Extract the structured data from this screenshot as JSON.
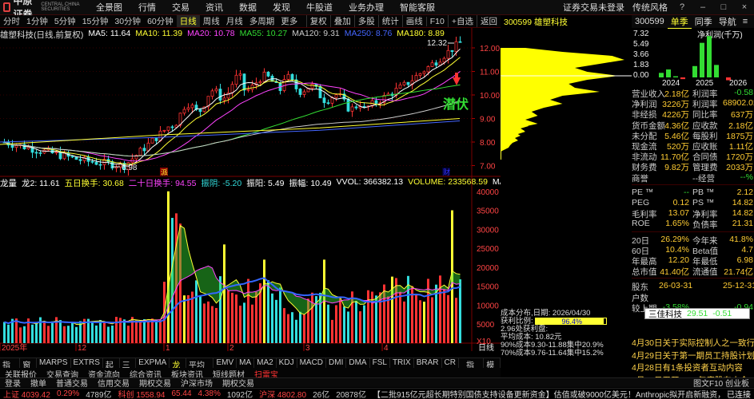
{
  "topbar": {
    "logo": "中原证券",
    "logo_sub": "CENTRAL CHINA SECURITIES",
    "menu": [
      "全景图",
      "行情",
      "交易",
      "资讯",
      "数据",
      "发现",
      "牛股道",
      "业务办理",
      "智能客服"
    ],
    "right": [
      "证券交易未登录",
      "传统风格"
    ]
  },
  "toolbar": {
    "periods": [
      "分时",
      "1分钟",
      "5分钟",
      "15分钟",
      "30分钟",
      "60分钟",
      "日线",
      "周线",
      "月线",
      "多周期",
      "更多"
    ],
    "active_period": "日线",
    "tools": [
      "复权",
      "叠加",
      "多股",
      "统计",
      "画线",
      "F10",
      "+自选",
      "返回"
    ]
  },
  "stock_label": "300599 雄塑科技",
  "ma_legend": {
    "title": "雄塑科技(日线,前复权)",
    "items": [
      {
        "text": "MA5: 11.64",
        "color": "#ffffff"
      },
      {
        "text": "MA10: 11.39",
        "color": "#ffff33"
      },
      {
        "text": "MA20: 10.78",
        "color": "#ff44ff"
      },
      {
        "text": "MA55: 10.27",
        "color": "#33dd33"
      },
      {
        "text": "MA120: 9.31",
        "color": "#cccccc"
      },
      {
        "text": "MA250: 8.76",
        "color": "#4466ff"
      },
      {
        "text": "MA180: 8.89",
        "color": "#ffff33"
      }
    ]
  },
  "price_axis": [
    "12.00",
    "11.00",
    "10.00",
    "9.00",
    "8.00",
    "7.00"
  ],
  "price_marks": {
    "high": "12.32",
    "low": "6.98",
    "event_1": "派",
    "event_2": "财"
  },
  "signal_text": "潜伏",
  "vol_legend": {
    "items": [
      {
        "text": "龙量",
        "color": "#ffffff"
      },
      {
        "text": "龙2: 11.61",
        "color": "#ffffff"
      },
      {
        "text": "五日换手: 30.68",
        "color": "#ffff33"
      },
      {
        "text": "二十日换手: 94.55",
        "color": "#ff44ff"
      },
      {
        "text": "振阴: -5.20",
        "color": "#33dddd"
      },
      {
        "text": "振阳: 5.49",
        "color": "#ffffff"
      },
      {
        "text": "振幅: 10.49",
        "color": "#ffffff"
      },
      {
        "text": "VVOL: 366382.13",
        "color": "#ffffff"
      },
      {
        "text": "VOLUME: 233568.59",
        "color": "#ffff33"
      },
      {
        "text": "MAVOL5:",
        "color": "#ffffff"
      }
    ]
  },
  "vol_axis": [
    "40000",
    "35000",
    "30000",
    "25000",
    "20000",
    "15000",
    "10000",
    "5000",
    "X10"
  ],
  "time_axis": [
    "2025年",
    "12",
    "1",
    "2",
    "3",
    "4"
  ],
  "chip": {
    "date_line": "成本分布,日期: 2026/04/30",
    "profit_label": "获利比例:",
    "profit_value": "96.4%",
    "profit_ratio": 0.964,
    "line2": "2.96处获利盘:",
    "line3": "平均成本: 10.82元",
    "line4": "90%成本9.30-11.88集中20.9%",
    "line5": "70%成本9.76-11.64集中15.2%"
  },
  "right_panel": {
    "code": "300599",
    "tabs": [
      "单季",
      "同季",
      "导航"
    ],
    "active_tab": "单季",
    "chart_title": "净利润(千万)",
    "chart_axis": [
      "7.32",
      "5.49",
      "3.66",
      "1.83",
      "0.00"
    ],
    "years": [
      "2024",
      "2025",
      "2026"
    ],
    "net_profit_bars": [
      {
        "q": "2024Q1",
        "v": 0.8
      },
      {
        "q": "2024Q2",
        "v": 1.4
      },
      {
        "q": "2024Q3",
        "v": 0.2
      },
      {
        "q": "2024Q4",
        "v": -0.3
      },
      {
        "q": "2025Q1",
        "v": 2.0
      },
      {
        "q": "2025Q2",
        "v": 6.1
      },
      {
        "q": "2025Q3",
        "v": 7.3
      },
      {
        "q": "2025Q4",
        "v": 2.2
      },
      {
        "q": "2026Q1",
        "v": -0.5
      }
    ],
    "fundamentals": [
      [
        "营业收入",
        "2.18亿",
        "利润率",
        "-0.58"
      ],
      [
        "净利润",
        "3226万",
        "利润率",
        "68902.02"
      ],
      [
        "非经损",
        "4226万",
        "同比率",
        "637万"
      ],
      [
        "货币金额",
        "4.36亿",
        "应收款",
        "2.18亿"
      ],
      [
        "未分配",
        "5.46亿",
        "每股利",
        "1875万"
      ],
      [
        "现金流",
        "520万",
        "应收账",
        "1.11亿"
      ],
      [
        "非流动",
        "11.70亿",
        "合同债",
        "1720万"
      ],
      [
        "财务费",
        "9.82万",
        "管理费",
        "2033万"
      ],
      [
        "商誉",
        "",
        "--经营",
        "--%"
      ]
    ],
    "valuation": [
      [
        "PE ™",
        "--",
        "PB ™",
        "2.12"
      ],
      [
        "PEG",
        "0.12",
        "PS ™",
        "14.82"
      ],
      [
        "毛利率",
        "13.07",
        "净利率",
        "14.82"
      ],
      [
        "ROE",
        "1.65%",
        "负债率",
        "21.31"
      ]
    ],
    "perf": [
      [
        "20日",
        "26.29%",
        "今年来",
        "41.8%"
      ],
      [
        "60日",
        "10.4%",
        "Beta值",
        "4.7"
      ],
      [
        "年最高",
        "12.20",
        "年最低",
        "6.98"
      ],
      [
        "总市值",
        "41.40亿",
        "流通值",
        "21.74亿"
      ]
    ],
    "holders": [
      [
        "股东",
        "26-03-31",
        "",
        "25-12-31"
      ],
      [
        "户数",
        "",
        "",
        ""
      ],
      [
        "较上期",
        "-3.58%",
        "",
        "-0.94"
      ]
    ],
    "hover_tip": {
      "name": "三佳科技",
      "price": "29.51",
      "change": "-0.51"
    },
    "news": [
      "4月30日关于实际控制人之一致行...",
      "4月29日关于第一期员工持股计划...",
      "4月28日有1条投资者互动内容",
      "5月15日召开2025年度股东大会"
    ]
  },
  "bottom_tabs": [
    "指标A",
    "窗口",
    "MARPS",
    "EXTRS",
    "起爆",
    "三线",
    "EXPMA",
    "龙量",
    "平均成本",
    "EMV",
    "MA",
    "MA2",
    "KDJ",
    "MACD",
    "DMI",
    "DMA",
    "FSL",
    "TRIX",
    "BRAR",
    "CR"
  ],
  "bottom_tabs_right": [
    "指标B",
    "模板"
  ],
  "bottom_tabs2": [
    "关联报价",
    "交易查询",
    "资金流向",
    "综合资讯",
    "板块资讯",
    "短线题材",
    "扫雷宝"
  ],
  "taskbar": [
    "登录",
    "撤单",
    "普通交易",
    "信用交易",
    "期权交易",
    "沪深市场",
    "期权交易"
  ],
  "taskbar_right": "图文F10 创业板",
  "statusbar": {
    "items": [
      {
        "text": "上证 4039.42",
        "color": "#ff4444"
      },
      {
        "text": "0.29%",
        "color": "#ff4444"
      },
      {
        "text": "4789亿",
        "color": "#cccccc"
      },
      {
        "text": "科创 1558.94",
        "color": "#ff4444"
      },
      {
        "text": "65.44",
        "color": "#ff4444"
      },
      {
        "text": "4.38%",
        "color": "#ff4444"
      },
      {
        "text": "1092亿",
        "color": "#cccccc"
      },
      {
        "text": "沪深 4802.80",
        "color": "#ff4444"
      },
      {
        "text": "26亿",
        "color": "#cccccc"
      },
      {
        "text": "20878亿",
        "color": "#cccccc"
      }
    ],
    "ticker": "【二批915亿元超长期特别国债支持设备更新资金】估值或破9000亿美元！Anthropic拟开启新融资，力压OpenAI争夺全",
    "right": "已连接"
  }
}
